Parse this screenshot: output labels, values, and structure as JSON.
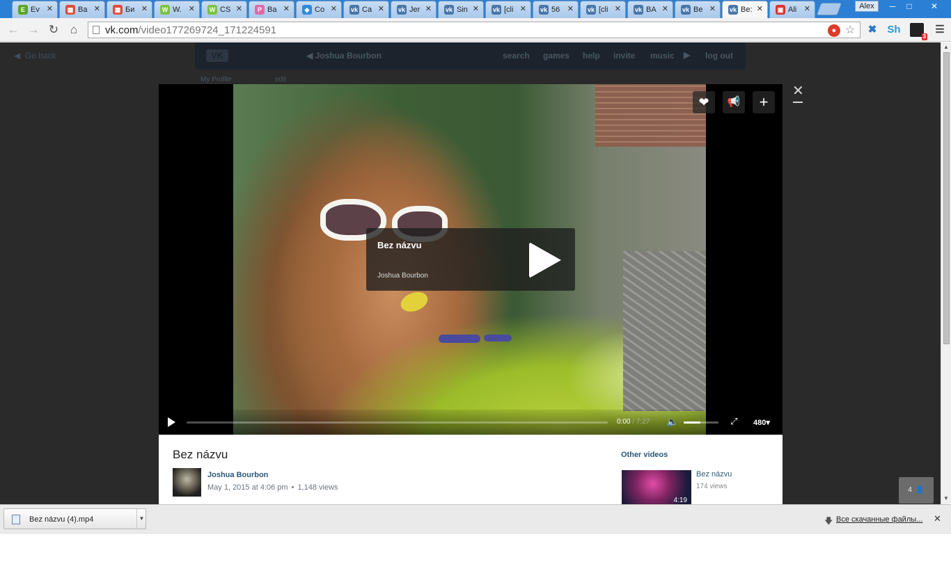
{
  "browser": {
    "tabs": [
      {
        "label": "Ev",
        "favicon": "evernote-icon",
        "color": "#5ba525"
      },
      {
        "label": "Ba",
        "favicon": "grid-icon",
        "color": "#e04b3a"
      },
      {
        "label": "Би",
        "favicon": "grid-icon",
        "color": "#e04b3a"
      },
      {
        "label": "W.",
        "favicon": "wm-icon",
        "color": "#7cc242"
      },
      {
        "label": "CS",
        "favicon": "wm-icon",
        "color": "#7cc242"
      },
      {
        "label": "Ba",
        "favicon": "p-icon",
        "color": "#e06aa8"
      },
      {
        "label": "Co",
        "favicon": "box-icon",
        "color": "#2f8ad8"
      },
      {
        "label": "Ca",
        "favicon": "vk-icon",
        "color": "#4a76a8"
      },
      {
        "label": "Jer",
        "favicon": "vk-icon",
        "color": "#4a76a8"
      },
      {
        "label": "Sin",
        "favicon": "vk-icon",
        "color": "#4a76a8"
      },
      {
        "label": "[cli",
        "favicon": "vk-icon",
        "color": "#4a76a8"
      },
      {
        "label": "56",
        "favicon": "vk-icon",
        "color": "#4a76a8"
      },
      {
        "label": "[cli",
        "favicon": "vk-icon",
        "color": "#4a76a8"
      },
      {
        "label": "BA",
        "favicon": "vk-icon",
        "color": "#4a76a8"
      },
      {
        "label": "Be",
        "favicon": "vk-icon",
        "color": "#4a76a8"
      },
      {
        "label": "Be:",
        "favicon": "vk-icon",
        "color": "#4a76a8",
        "active": true
      },
      {
        "label": "Ali",
        "favicon": "cart-icon",
        "color": "#e03030"
      }
    ],
    "profile_name": "Alex",
    "url_host": "vk.com",
    "url_path": "/video177269724_171224591",
    "extension_badge": "3"
  },
  "page": {
    "go_back": "Go back",
    "header": {
      "logo": "VK",
      "user": "Joshua Bourbon",
      "nav": [
        "search",
        "games",
        "help",
        "invite",
        "music",
        "log out"
      ]
    },
    "sidebar": {
      "my_profile": "My Profile",
      "edit": "edit"
    }
  },
  "video": {
    "overlay_title": "Bez názvu",
    "overlay_author": "Joshua Bourbon",
    "progress_fraction": 0.0,
    "volume_fraction": 0.48,
    "time_current": "0:00",
    "time_separator": "/",
    "time_duration": "7:27",
    "quality": "480",
    "title": "Bez názvu",
    "uploader": "Joshua Bourbon",
    "upload_date": "May 1, 2015 at 4:06 pm",
    "views": "1,148 views",
    "other_videos": {
      "heading": "Other videos",
      "items": [
        {
          "title": "Bez názvu",
          "views": "174 views",
          "duration": "4:19"
        }
      ]
    },
    "people_count": "4"
  },
  "downloads": {
    "file_name": "Bez názvu (4).mp4",
    "all_downloads": "Все скачанные файлы..."
  }
}
